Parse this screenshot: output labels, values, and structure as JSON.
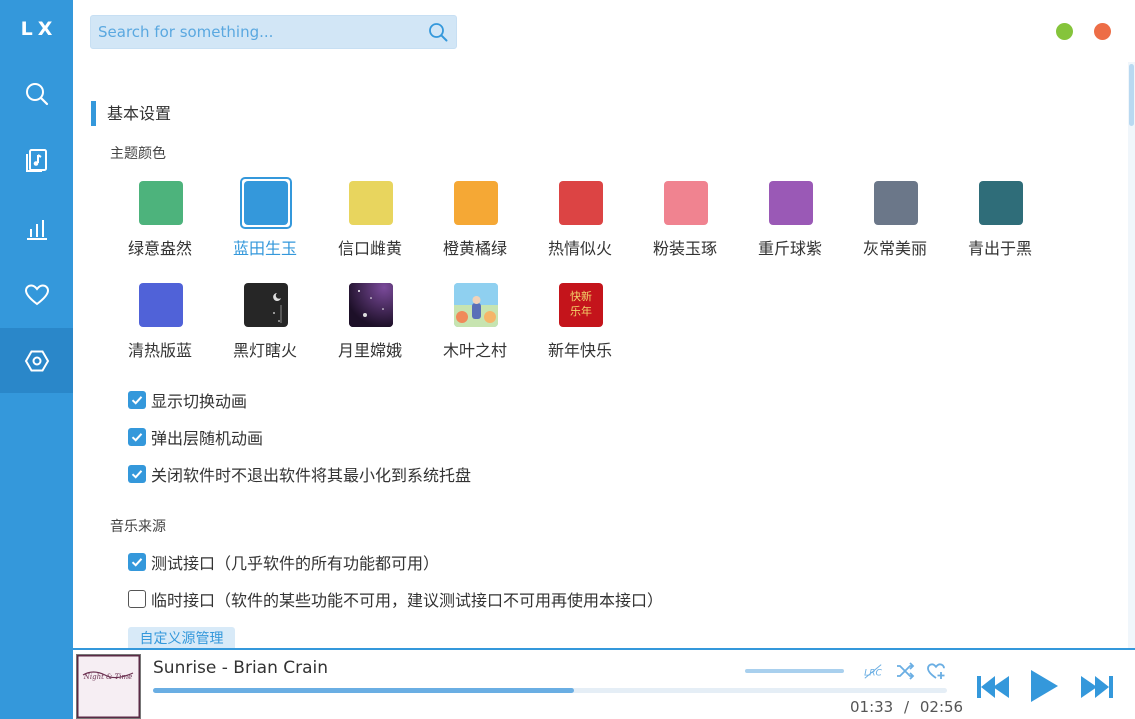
{
  "app": {
    "logo": "LX"
  },
  "sidebar": {
    "items": [
      {
        "icon": "search-icon"
      },
      {
        "icon": "music-list-icon"
      },
      {
        "icon": "leaderboard-icon"
      },
      {
        "icon": "heart-icon"
      },
      {
        "icon": "settings-icon",
        "active": true
      }
    ]
  },
  "search": {
    "placeholder": "Search for something..."
  },
  "settings": {
    "section_title": "基本设置",
    "theme_title": "主题颜色",
    "themes": [
      {
        "label": "绿意盎然",
        "color": "#4db37c"
      },
      {
        "label": "蓝田生玉",
        "color": "#3498db",
        "active": true
      },
      {
        "label": "信口雌黄",
        "color": "#e8d55e"
      },
      {
        "label": "橙黄橘绿",
        "color": "#f5a835"
      },
      {
        "label": "热情似火",
        "color": "#dc4444"
      },
      {
        "label": "粉装玉琢",
        "color": "#f08390"
      },
      {
        "label": "重斤球紫",
        "color": "#9a59b6"
      },
      {
        "label": "灰常美丽",
        "color": "#6b7789"
      },
      {
        "label": "青出于黑",
        "color": "#2f6d79"
      },
      {
        "label": "清热版蓝",
        "color": "#5062d8"
      },
      {
        "label": "黑灯瞎火",
        "color": "#262626"
      },
      {
        "label": "月里嫦娥",
        "color": "#2a1738"
      },
      {
        "label": "木叶之村",
        "color": "#7fc5e8"
      },
      {
        "label": "新年快乐",
        "color": "#c4141b",
        "image_text": "快新乐年"
      }
    ],
    "options": [
      {
        "label": "显示切换动画",
        "checked": true
      },
      {
        "label": "弹出层随机动画",
        "checked": true
      },
      {
        "label": "关闭软件时不退出软件将其最小化到系统托盘",
        "checked": true
      }
    ],
    "source_title": "音乐来源",
    "sources": [
      {
        "label": "测试接口（几乎软件的所有功能都可用）",
        "checked": true
      },
      {
        "label": "临时接口（软件的某些功能不可用，建议测试接口不可用再使用本接口）",
        "checked": false
      }
    ],
    "custom_source_button": "自定义源管理"
  },
  "player": {
    "title": "Sunrise - Brian Crain",
    "current_time": "01:33",
    "separator": "/",
    "total_time": "02:56",
    "progress": 0.53,
    "volume": 1.0,
    "cover_text": "Night & Time",
    "lyric_label": "LRC"
  }
}
